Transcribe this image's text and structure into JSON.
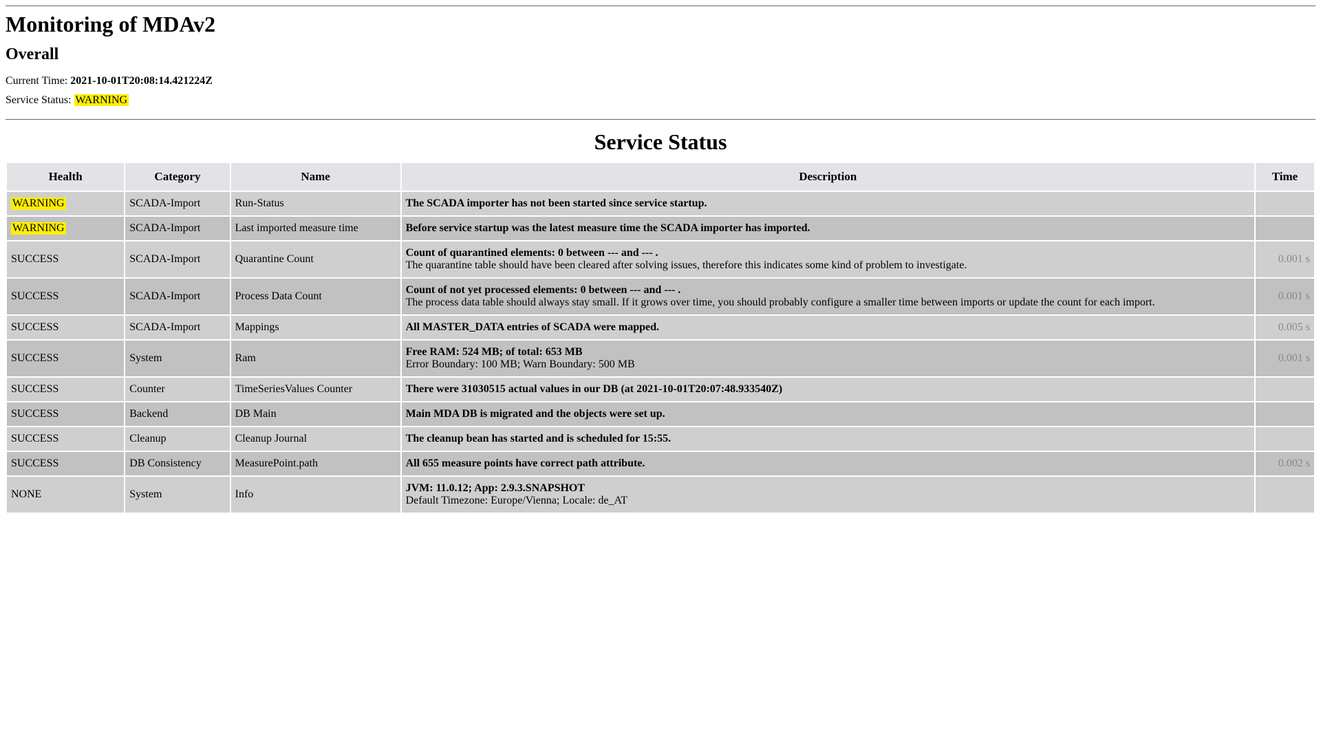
{
  "page_title": "Monitoring of MDAv2",
  "section_overall_heading": "Overall",
  "current_time_label": "Current Time: ",
  "current_time_value": "2021-10-01T20:08:14.421224Z",
  "service_status_label": "Service Status: ",
  "service_status_value": "WARNING",
  "service_status_heading": "Service Status",
  "columns": {
    "health": "Health",
    "category": "Category",
    "name": "Name",
    "description": "Description",
    "time": "Time"
  },
  "rows": [
    {
      "health": "WARNING",
      "health_highlight": true,
      "category": "SCADA-Import",
      "name": "Run-Status",
      "desc_main": "The SCADA importer has not been started since service startup.",
      "desc_sub": "",
      "time": ""
    },
    {
      "health": "WARNING",
      "health_highlight": true,
      "category": "SCADA-Import",
      "name": "Last imported measure time",
      "desc_main": "Before service startup was the latest measure time the SCADA importer has imported.",
      "desc_sub": "",
      "time": ""
    },
    {
      "health": "SUCCESS",
      "health_highlight": false,
      "category": "SCADA-Import",
      "name": "Quarantine Count",
      "desc_main": "Count of quarantined elements: 0 between --- and --- .",
      "desc_sub": "The quarantine table should have been cleared after solving issues, therefore this indicates some kind of problem to investigate.",
      "time": "0.001 s"
    },
    {
      "health": "SUCCESS",
      "health_highlight": false,
      "category": "SCADA-Import",
      "name": "Process Data Count",
      "desc_main": "Count of not yet processed elements: 0 between --- and --- .",
      "desc_sub": "The process data table should always stay small. If it grows over time, you should probably configure a smaller time between imports or update the count for each import.",
      "time": "0.001 s"
    },
    {
      "health": "SUCCESS",
      "health_highlight": false,
      "category": "SCADA-Import",
      "name": "Mappings",
      "desc_main": "All MASTER_DATA entries of SCADA were mapped.",
      "desc_sub": "",
      "time": "0.005 s"
    },
    {
      "health": "SUCCESS",
      "health_highlight": false,
      "category": "System",
      "name": "Ram",
      "desc_main": "Free RAM: 524 MB; of total: 653 MB",
      "desc_sub": "Error Boundary: 100 MB; Warn Boundary: 500 MB",
      "time": "0.001 s"
    },
    {
      "health": "SUCCESS",
      "health_highlight": false,
      "category": "Counter",
      "name": "TimeSeriesValues Counter",
      "desc_main": "There were 31030515 actual values in our DB (at 2021-10-01T20:07:48.933540Z)",
      "desc_sub": "",
      "time": ""
    },
    {
      "health": "SUCCESS",
      "health_highlight": false,
      "category": "Backend",
      "name": "DB Main",
      "desc_main": "Main MDA DB is migrated and the objects were set up.",
      "desc_sub": "",
      "time": ""
    },
    {
      "health": "SUCCESS",
      "health_highlight": false,
      "category": "Cleanup",
      "name": "Cleanup Journal",
      "desc_main": "The cleanup bean has started and is scheduled for 15:55.",
      "desc_sub": "",
      "time": ""
    },
    {
      "health": "SUCCESS",
      "health_highlight": false,
      "category": "DB Consistency",
      "name": "MeasurePoint.path",
      "desc_main": "All 655 measure points have correct path attribute.",
      "desc_sub": "",
      "time": "0.002 s"
    },
    {
      "health": "NONE",
      "health_highlight": false,
      "category": "System",
      "name": "Info",
      "desc_main": "JVM: 11.0.12; App: 2.9.3.SNAPSHOT",
      "desc_sub": "Default Timezone: Europe/Vienna; Locale: de_AT",
      "time": ""
    }
  ]
}
